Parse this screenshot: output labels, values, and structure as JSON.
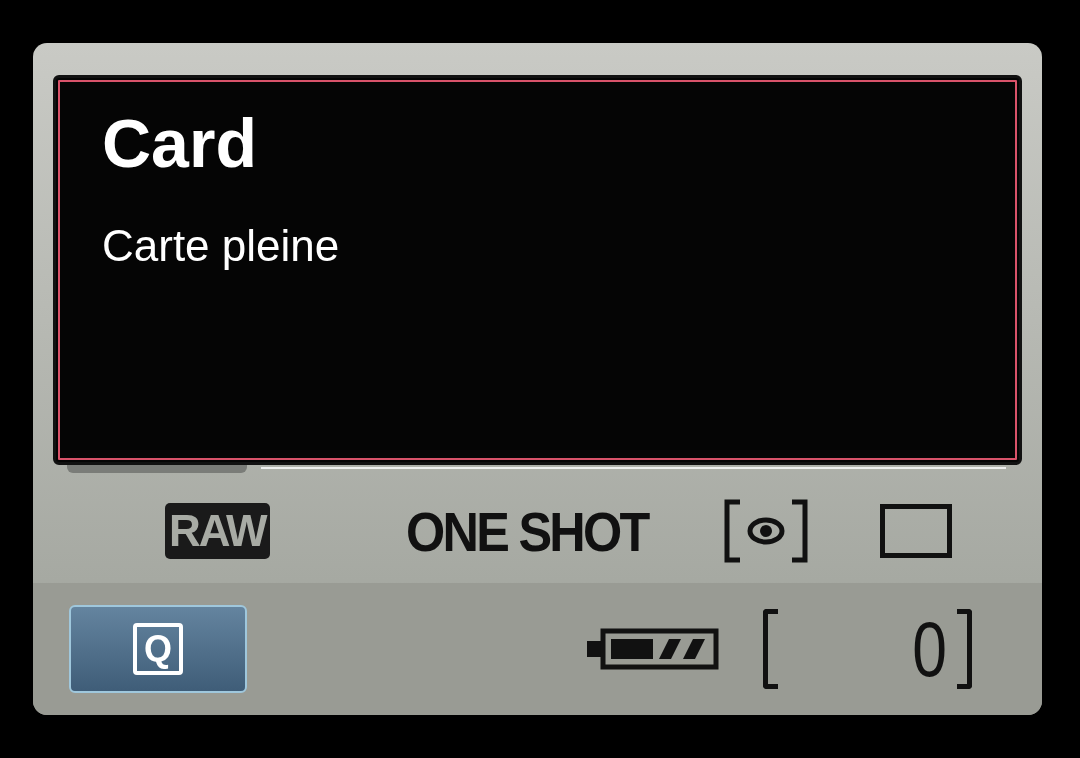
{
  "message": {
    "title": "Card",
    "text": "Carte pleine"
  },
  "settings": {
    "quality": "RAW",
    "af_mode": "ONE SHOT"
  },
  "quick_button": {
    "label": "Q"
  },
  "shots_remaining": "0"
}
